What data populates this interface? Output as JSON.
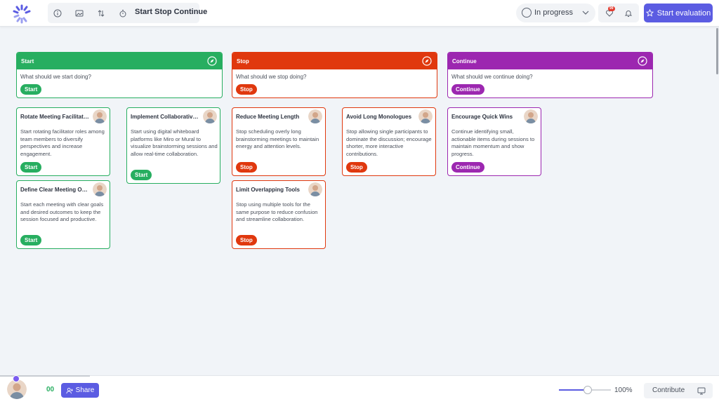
{
  "header": {
    "title": "Start Stop Continue",
    "status": "In progress",
    "notification_badge": "99",
    "start_button": "Start evaluation",
    "icons": [
      "info-icon",
      "image-icon",
      "sort-icon",
      "timer-icon",
      "heart-icon",
      "bell-icon",
      "star-icon",
      "chevron-down-icon"
    ]
  },
  "columns": [
    {
      "name": "Start",
      "prompt": "What should we start doing?",
      "tag": "Start"
    },
    {
      "name": "Stop",
      "prompt": "What should we stop doing?",
      "tag": "Stop"
    },
    {
      "name": "Continue",
      "prompt": "What should we continue doing?",
      "tag": "Continue"
    }
  ],
  "cards": [
    {
      "title": "Rotate Meeting Facilitators",
      "body": "Start rotating facilitator roles among team members to diversify perspectives and increase engagement.",
      "tag": "Start"
    },
    {
      "title": "Implement Collaborative Tools",
      "body": "Start using digital whiteboard platforms like Miro or Mural to visualize brainstorming sessions and allow real-time collaboration.",
      "tag": "Start"
    },
    {
      "title": "Define Clear Meeting Objectives",
      "body": "Start each meeting with clear goals and desired outcomes to keep the session focused and productive.",
      "tag": "Start"
    },
    {
      "title": "Reduce Meeting Length",
      "body": "Stop scheduling overly long brainstorming meetings to maintain energy and attention levels.",
      "tag": "Stop"
    },
    {
      "title": "Avoid Long Monologues",
      "body": "Stop allowing single participants to dominate the discussion; encourage shorter, more interactive contributions.",
      "tag": "Stop"
    },
    {
      "title": "Limit Overlapping Tools",
      "body": "Stop using multiple tools for the same purpose to reduce confusion and streamline collaboration.",
      "tag": "Stop"
    },
    {
      "title": "Encourage Quick Wins",
      "body": "Continue identifying small, actionable items during sessions to maintain momentum and show progress.",
      "tag": "Continue"
    }
  ],
  "footer": {
    "timer": "00",
    "share": "Share",
    "zoom": "100%",
    "zoom_level": 0.55,
    "contribute": "Contribute"
  },
  "colors": {
    "start": "#27ae60",
    "stop": "#e0380e",
    "continue": "#9c27b0",
    "accent": "#5b5ce2"
  }
}
